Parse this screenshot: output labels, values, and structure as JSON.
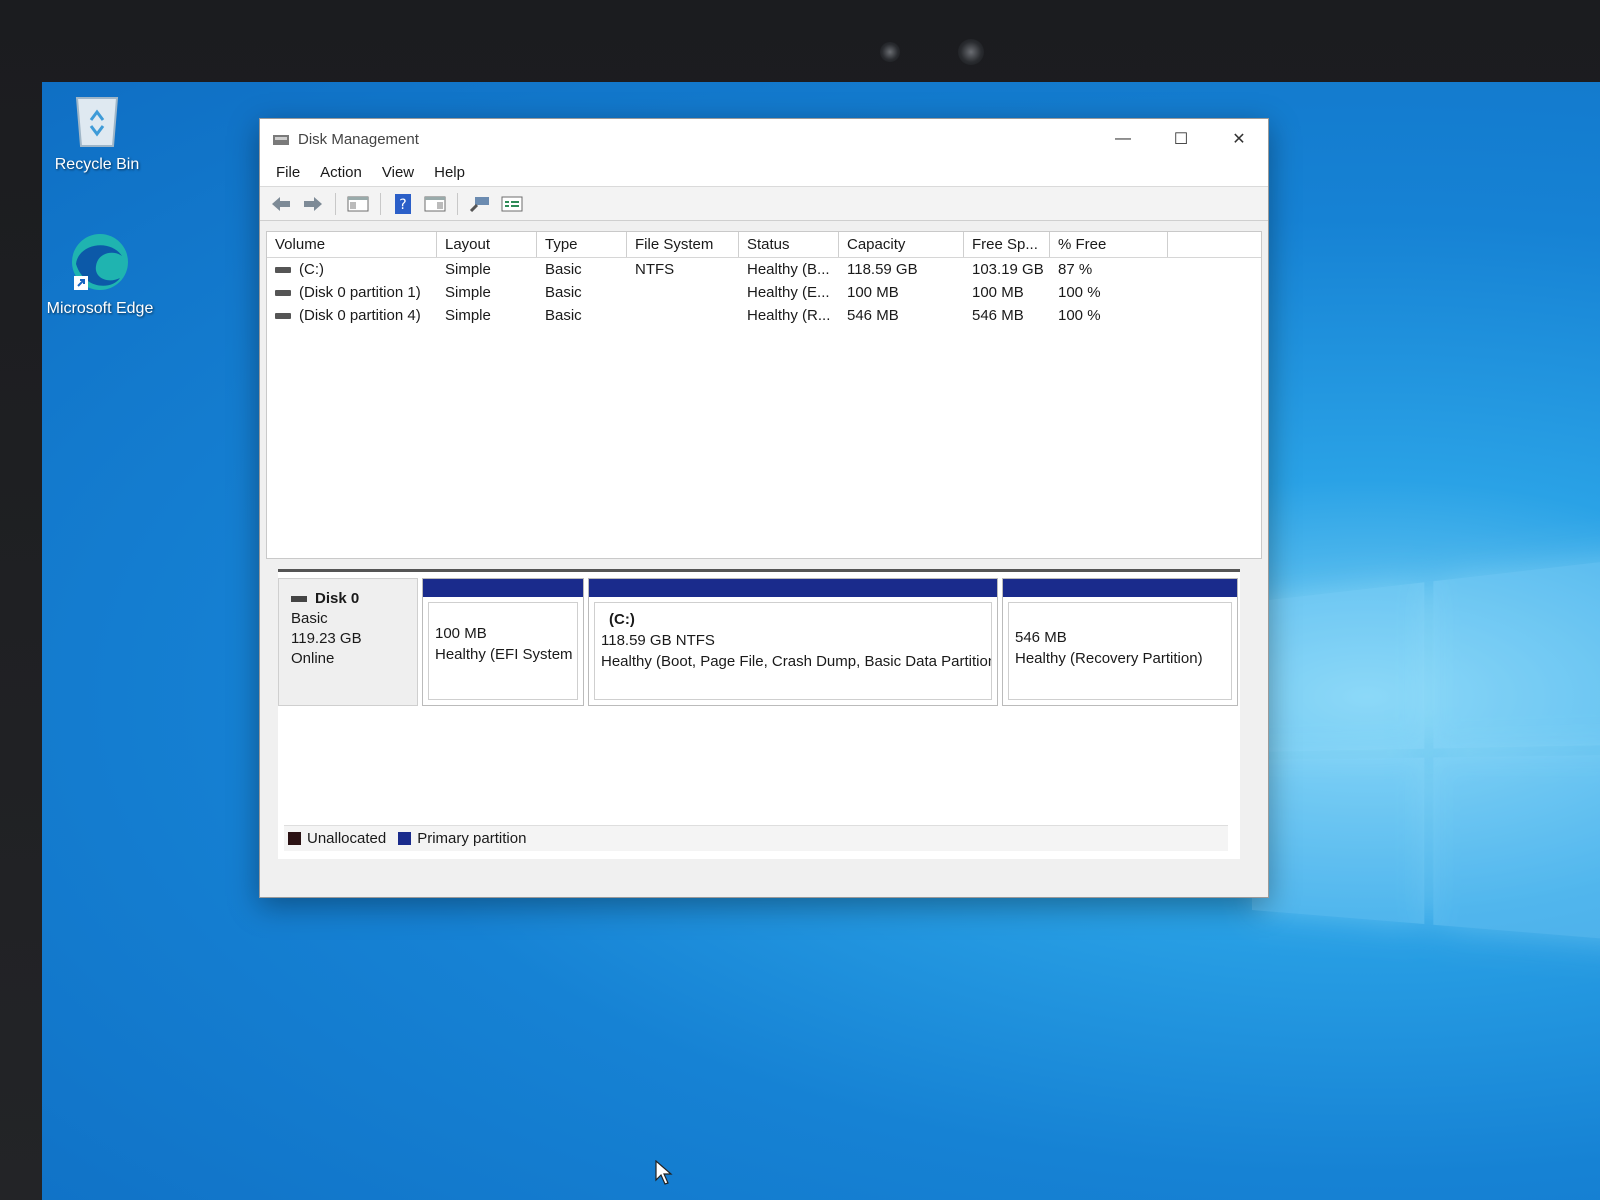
{
  "colors": {
    "primary_partition": "#1a2b8c",
    "unallocated": "#2b1214",
    "desktop_accent": "#1682d4"
  },
  "desktop": {
    "icons": [
      {
        "label": "Recycle Bin",
        "icon": "recycle-bin-icon"
      },
      {
        "label": "Microsoft Edge",
        "icon": "edge-icon"
      }
    ]
  },
  "window": {
    "title": "Disk Management",
    "controls": {
      "minimize": "—",
      "maximize": "☐",
      "close": "✕"
    }
  },
  "menu": [
    "File",
    "Action",
    "View",
    "Help"
  ],
  "toolbar": [
    "back-icon",
    "forward-icon",
    "console-tree-icon",
    "help-icon",
    "details-icon",
    "connect-icon",
    "properties-icon"
  ],
  "volumes": {
    "columns": [
      "Volume",
      "Layout",
      "Type",
      "File System",
      "Status",
      "Capacity",
      "Free Sp...",
      "% Free"
    ],
    "rows": [
      {
        "volume": "(C:)",
        "layout": "Simple",
        "type": "Basic",
        "fs": "NTFS",
        "status": "Healthy (B...",
        "capacity": "118.59 GB",
        "free": "103.19 GB",
        "pct": "87 %"
      },
      {
        "volume": "(Disk 0 partition 1)",
        "layout": "Simple",
        "type": "Basic",
        "fs": "",
        "status": "Healthy (E...",
        "capacity": "100 MB",
        "free": "100 MB",
        "pct": "100 %"
      },
      {
        "volume": "(Disk 0 partition 4)",
        "layout": "Simple",
        "type": "Basic",
        "fs": "",
        "status": "Healthy (R...",
        "capacity": "546 MB",
        "free": "546 MB",
        "pct": "100 %"
      }
    ]
  },
  "disk0": {
    "name": "Disk 0",
    "type": "Basic",
    "size": "119.23 GB",
    "state": "Online",
    "partitions": [
      {
        "title": "",
        "size": "100 MB",
        "status": "Healthy (EFI System P"
      },
      {
        "title": "(C:)",
        "size": "118.59 GB NTFS",
        "status": "Healthy (Boot, Page File, Crash Dump, Basic Data Partition)"
      },
      {
        "title": "",
        "size": "546 MB",
        "status": "Healthy (Recovery Partition)"
      }
    ]
  },
  "legend": {
    "unallocated": "Unallocated",
    "primary": "Primary partition"
  }
}
